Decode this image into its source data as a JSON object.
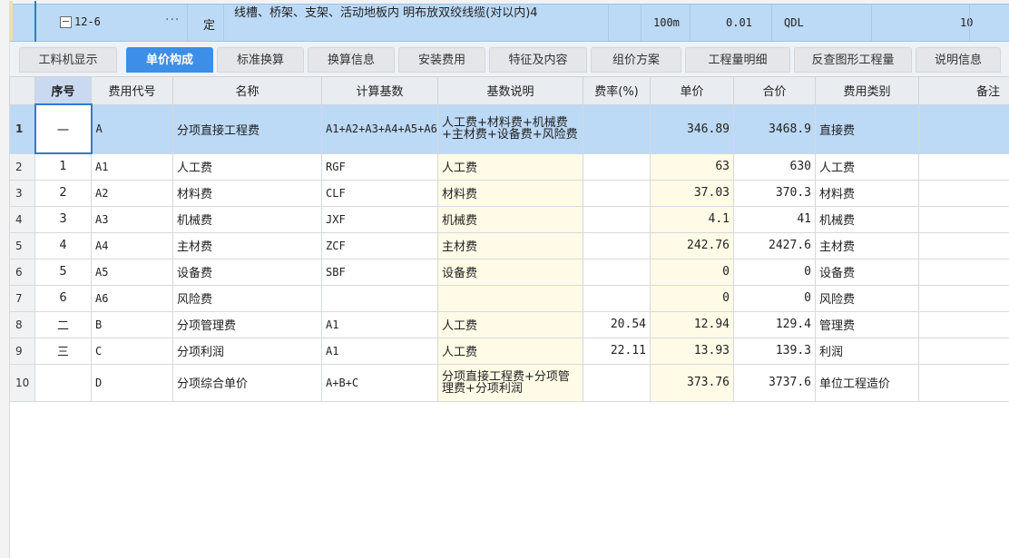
{
  "top_item": {
    "code": "12-6",
    "ellipsis": "···",
    "type": "定",
    "name": "线槽、桥架、支架、活动地板内 明布放双绞线缆(对以内)4",
    "unit": "100m",
    "quantity": "0.01",
    "qdl": "QDL",
    "amount": "10",
    "expand_symbol": "−"
  },
  "tabs": [
    {
      "label": "工料机显示",
      "active": false
    },
    {
      "label": "单价构成",
      "active": true
    },
    {
      "label": "标准换算",
      "active": false
    },
    {
      "label": "换算信息",
      "active": false
    },
    {
      "label": "安装费用",
      "active": false
    },
    {
      "label": "特征及内容",
      "active": false
    },
    {
      "label": "组价方案",
      "active": false
    },
    {
      "label": "工程量明细",
      "active": false
    },
    {
      "label": "反查图形工程量",
      "active": false
    },
    {
      "label": "说明信息",
      "active": false
    }
  ],
  "columns": {
    "seq": "序号",
    "code": "费用代号",
    "name": "名称",
    "base": "计算基数",
    "base_desc": "基数说明",
    "rate": "费率(%)",
    "unit_price": "单价",
    "total": "合价",
    "category": "费用类别",
    "remark": "备注"
  },
  "rows": [
    {
      "idx": "1",
      "seq": "一",
      "code": "A",
      "name": "分项直接工程费",
      "base": "A1+A2+A3+A4+A5+A6",
      "base_desc": "人工费+材料费+机械费+主材费+设备费+风险费",
      "rate": "",
      "unit_price": "346.89",
      "total": "3468.9",
      "category": "直接费",
      "remark": ""
    },
    {
      "idx": "2",
      "seq": "1",
      "code": "A1",
      "name": "人工费",
      "base": "RGF",
      "base_desc": "人工费",
      "rate": "",
      "unit_price": "63",
      "total": "630",
      "category": "人工费",
      "remark": ""
    },
    {
      "idx": "3",
      "seq": "2",
      "code": "A2",
      "name": "材料费",
      "base": "CLF",
      "base_desc": "材料费",
      "rate": "",
      "unit_price": "37.03",
      "total": "370.3",
      "category": "材料费",
      "remark": ""
    },
    {
      "idx": "4",
      "seq": "3",
      "code": "A3",
      "name": "机械费",
      "base": "JXF",
      "base_desc": "机械费",
      "rate": "",
      "unit_price": "4.1",
      "total": "41",
      "category": "机械费",
      "remark": ""
    },
    {
      "idx": "5",
      "seq": "4",
      "code": "A4",
      "name": "主材费",
      "base": "ZCF",
      "base_desc": "主材费",
      "rate": "",
      "unit_price": "242.76",
      "total": "2427.6",
      "category": "主材费",
      "remark": ""
    },
    {
      "idx": "6",
      "seq": "5",
      "code": "A5",
      "name": "设备费",
      "base": "SBF",
      "base_desc": "设备费",
      "rate": "",
      "unit_price": "0",
      "total": "0",
      "category": "设备费",
      "remark": ""
    },
    {
      "idx": "7",
      "seq": "6",
      "code": "A6",
      "name": "风险费",
      "base": "",
      "base_desc": "",
      "rate": "",
      "unit_price": "0",
      "total": "0",
      "category": "风险费",
      "remark": ""
    },
    {
      "idx": "8",
      "seq": "二",
      "code": "B",
      "name": "分项管理费",
      "base": "A1",
      "base_desc": "人工费",
      "rate": "20.54",
      "unit_price": "12.94",
      "total": "129.4",
      "category": "管理费",
      "remark": ""
    },
    {
      "idx": "9",
      "seq": "三",
      "code": "C",
      "name": "分项利润",
      "base": "A1",
      "base_desc": "人工费",
      "rate": "22.11",
      "unit_price": "13.93",
      "total": "139.3",
      "category": "利润",
      "remark": ""
    },
    {
      "idx": "10",
      "seq": "",
      "code": "D",
      "name": "分项综合单价",
      "base": "A+B+C",
      "base_desc": "分项直接工程费+分项管理费+分项利润",
      "rate": "",
      "unit_price": "373.76",
      "total": "3737.6",
      "category": "单位工程造价",
      "remark": ""
    }
  ]
}
